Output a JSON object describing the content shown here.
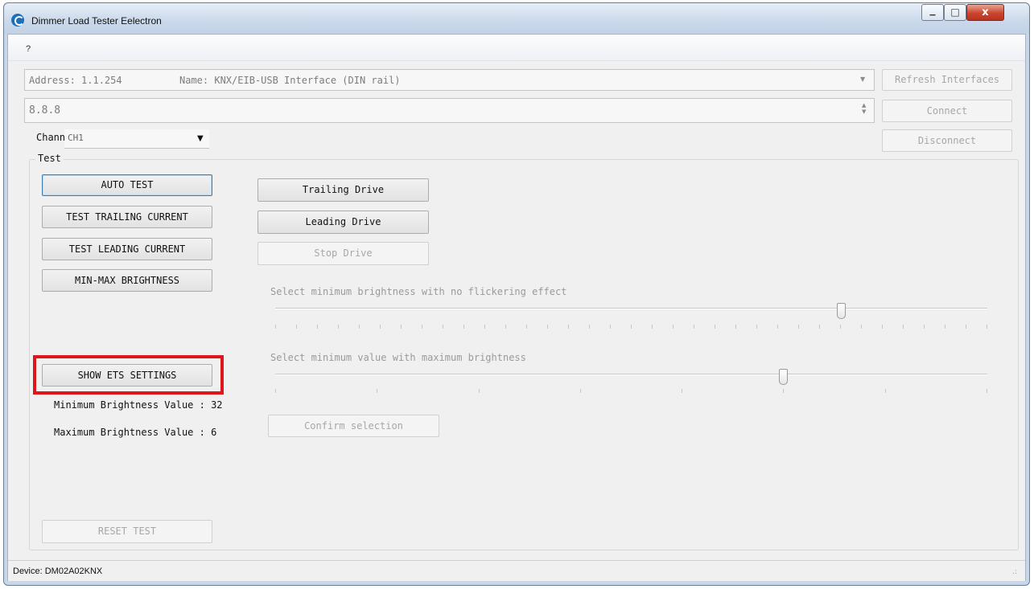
{
  "window": {
    "title": "Dimmer Load Tester Eelectron",
    "minimize_glyph": "▁",
    "maximize_glyph": "□",
    "close_glyph": "x"
  },
  "menu": {
    "items": [
      "?"
    ]
  },
  "interface": {
    "address_label": "Address: 1.1.254",
    "name_label": "Name: KNX/EIB-USB Interface (DIN rail)",
    "refresh_button": "Refresh Interfaces",
    "ip_value": "8.8.8",
    "connect_button": "Connect",
    "disconnect_button": "Disconnect"
  },
  "channel": {
    "label": "Channel",
    "selected": "CH1"
  },
  "test_group": {
    "label": "Test",
    "buttons": {
      "auto_test": "AUTO TEST",
      "test_trailing": "TEST TRAILING CURRENT",
      "test_leading": "TEST LEADING CURRENT",
      "min_max": "MIN-MAX BRIGHTNESS",
      "show_ets": "SHOW ETS SETTINGS",
      "reset_test": "RESET TEST"
    },
    "drive": {
      "trailing": "Trailing Drive",
      "leading": "Leading Drive",
      "stop": "Stop Drive"
    },
    "results": {
      "min_brightness": "Minimum Brightness Value : 32",
      "max_brightness": "Maximum Brightness Value : 6"
    },
    "slider_min": {
      "label": "Select minimum brightness with no flickering effect",
      "ticks": 35,
      "value_fraction": 0.795
    },
    "slider_max": {
      "label": "Select minimum value with maximum brightness",
      "ticks": 8,
      "value_fraction": 0.714
    },
    "confirm_button": "Confirm selection"
  },
  "status": {
    "device": "Device: DM02A02KNX"
  },
  "colors": {
    "highlight": "#e0141b",
    "accent": "#1d6fb8"
  }
}
